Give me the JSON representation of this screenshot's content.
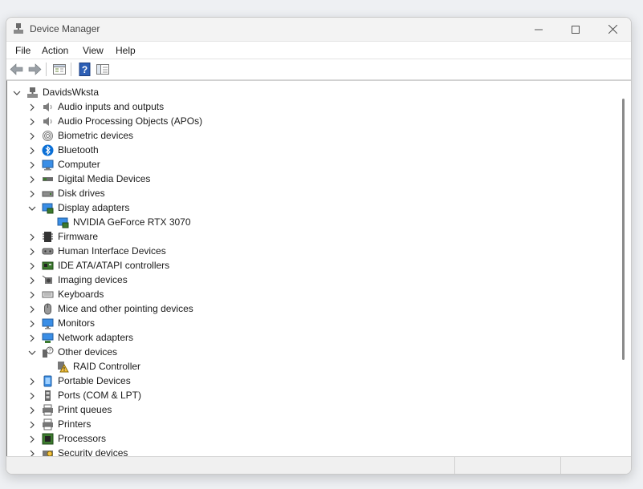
{
  "window": {
    "title": "Device Manager"
  },
  "menu": [
    "File",
    "Action",
    "View",
    "Help"
  ],
  "toolbar": {
    "buttons": [
      "back-icon",
      "forward-icon",
      "properties-icon",
      "help-icon",
      "show-hide-icon"
    ]
  },
  "tree": {
    "root": "DavidsWksta",
    "nodes": [
      {
        "label": "Audio inputs and outputs",
        "icon": "speaker-icon",
        "expanded": false,
        "level": 1
      },
      {
        "label": "Audio Processing Objects (APOs)",
        "icon": "speaker-icon",
        "expanded": false,
        "level": 1
      },
      {
        "label": "Biometric devices",
        "icon": "fingerprint-icon",
        "expanded": false,
        "level": 1
      },
      {
        "label": "Bluetooth",
        "icon": "bluetooth-icon",
        "expanded": false,
        "level": 1
      },
      {
        "label": "Computer",
        "icon": "computer-icon",
        "expanded": false,
        "level": 1
      },
      {
        "label": "Digital Media Devices",
        "icon": "media-device-icon",
        "expanded": false,
        "level": 1
      },
      {
        "label": "Disk drives",
        "icon": "disk-icon",
        "expanded": false,
        "level": 1
      },
      {
        "label": "Display adapters",
        "icon": "display-adapter-icon",
        "expanded": true,
        "level": 1
      },
      {
        "label": "NVIDIA GeForce RTX 3070",
        "icon": "display-adapter-icon",
        "level": 2
      },
      {
        "label": "Firmware",
        "icon": "firmware-icon",
        "expanded": false,
        "level": 1
      },
      {
        "label": "Human Interface Devices",
        "icon": "hid-icon",
        "expanded": false,
        "level": 1
      },
      {
        "label": "IDE ATA/ATAPI controllers",
        "icon": "controller-icon",
        "expanded": false,
        "level": 1
      },
      {
        "label": "Imaging devices",
        "icon": "camera-icon",
        "expanded": false,
        "level": 1
      },
      {
        "label": "Keyboards",
        "icon": "keyboard-icon",
        "expanded": false,
        "level": 1
      },
      {
        "label": "Mice and other pointing devices",
        "icon": "mouse-icon",
        "expanded": false,
        "level": 1
      },
      {
        "label": "Monitors",
        "icon": "monitor-icon",
        "expanded": false,
        "level": 1
      },
      {
        "label": "Network adapters",
        "icon": "network-icon",
        "expanded": false,
        "level": 1
      },
      {
        "label": "Other devices",
        "icon": "unknown-device-icon",
        "expanded": true,
        "level": 1
      },
      {
        "label": "RAID Controller",
        "icon": "warning-device-icon",
        "level": 2
      },
      {
        "label": "Portable Devices",
        "icon": "portable-icon",
        "expanded": false,
        "level": 1
      },
      {
        "label": "Ports (COM & LPT)",
        "icon": "port-icon",
        "expanded": false,
        "level": 1
      },
      {
        "label": "Print queues",
        "icon": "printer-icon",
        "expanded": false,
        "level": 1
      },
      {
        "label": "Printers",
        "icon": "printer-icon",
        "expanded": false,
        "level": 1
      },
      {
        "label": "Processors",
        "icon": "processor-icon",
        "expanded": false,
        "level": 1
      },
      {
        "label": "Security devices",
        "icon": "security-icon",
        "expanded": false,
        "level": 1
      }
    ]
  },
  "colors": {
    "accent": "#0078d4",
    "chip_green": "#3c7a2e",
    "monitor_blue": "#3a8ee6"
  }
}
